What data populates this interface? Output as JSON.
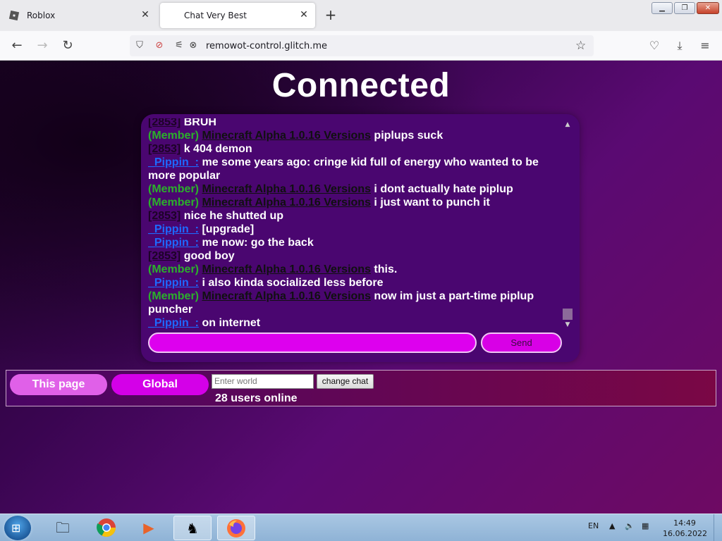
{
  "browser": {
    "tabs": [
      {
        "label": "Roblox",
        "active": false
      },
      {
        "label": "Chat Very Best",
        "active": true
      }
    ],
    "url": "remowot-control.glitch.me"
  },
  "page": {
    "heading": "Connected",
    "messages": [
      {
        "tag": "",
        "name": "[2853]",
        "name_type": "id",
        "text": "BRUH"
      },
      {
        "tag": "(Member)",
        "name": "Minecraft Alpha 1.0.16 Versions",
        "name_type": "member",
        "text": "piplups suck"
      },
      {
        "tag": "",
        "name": "[2853]",
        "name_type": "id",
        "text": "k 404 demon"
      },
      {
        "tag": "",
        "name": "_Pippin_:",
        "name_type": "pippin",
        "text": "me some years ago: cringe kid full of energy who wanted to be more popular"
      },
      {
        "tag": "(Member)",
        "name": "Minecraft Alpha 1.0.16 Versions",
        "name_type": "member",
        "text": "i dont actually hate piplup"
      },
      {
        "tag": "(Member)",
        "name": "Minecraft Alpha 1.0.16 Versions",
        "name_type": "member",
        "text": "i just want to punch it"
      },
      {
        "tag": "",
        "name": "[2853]",
        "name_type": "id",
        "text": "nice he shutted up"
      },
      {
        "tag": "",
        "name": "_Pippin_:",
        "name_type": "pippin",
        "text": "[upgrade]"
      },
      {
        "tag": "",
        "name": "_Pippin_:",
        "name_type": "pippin",
        "text": "me now: go the back"
      },
      {
        "tag": "",
        "name": "[2853]",
        "name_type": "id",
        "text": "good boy"
      },
      {
        "tag": "(Member)",
        "name": "Minecraft Alpha 1.0.16 Versions",
        "name_type": "member",
        "text": "this."
      },
      {
        "tag": "",
        "name": "_Pippin_:",
        "name_type": "pippin",
        "text": "i also kinda socialized less before"
      },
      {
        "tag": "(Member)",
        "name": "Minecraft Alpha 1.0.16 Versions",
        "name_type": "member",
        "text": "now im just a part-time piplup puncher"
      },
      {
        "tag": "",
        "name": "_Pippin_:",
        "name_type": "pippin",
        "text": "on internet"
      }
    ],
    "chat_input_value": "",
    "send_label": "Send",
    "tab_this_page": "This page",
    "tab_global": "Global",
    "world_placeholder": "Enter world",
    "change_chat_label": "change chat",
    "users_online": "28 users online"
  },
  "taskbar": {
    "language": "EN",
    "time": "14:49",
    "date": "16.06.2022"
  },
  "colors": {
    "accent": "#d800e6",
    "member_tag": "#2bb02b",
    "pippin_name": "#1e6aff"
  }
}
